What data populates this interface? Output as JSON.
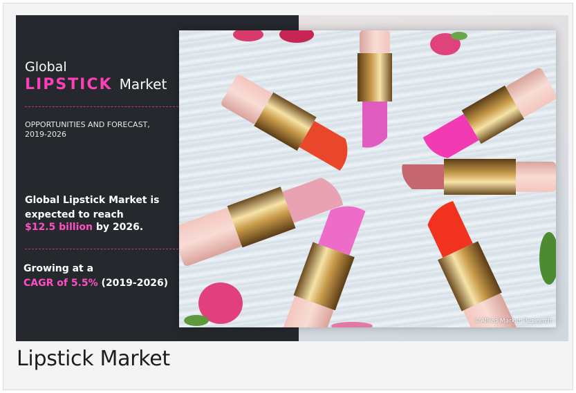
{
  "banner": {
    "title_line1": "Global",
    "title_keyword": "LIPSTICK",
    "title_suffix": "Market",
    "subtitle_line1": "OPPORTUNITIES AND FORECAST,",
    "subtitle_line2": "2019-2026",
    "expected_text": "Global Lipstick Market is expected to reach",
    "value_highlight": "$12.5 billion",
    "value_suffix": " by 2026.",
    "growing_text": "Growing at a",
    "cagr_highlight": "CAGR of 5.5%",
    "cagr_suffix": " (2019-2026)",
    "watermark": "©Allied Market Research"
  },
  "caption": "Lipstick Market",
  "colors": {
    "panel_bg": "#25292e",
    "accent_pink": "#ff3fb8"
  }
}
